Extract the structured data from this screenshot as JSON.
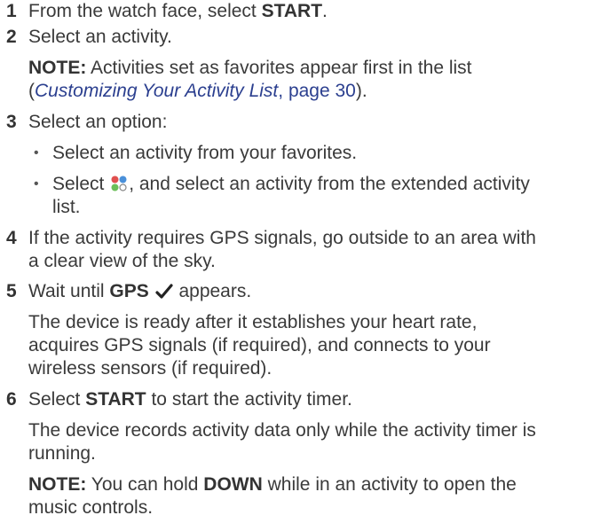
{
  "steps": [
    {
      "number": "1",
      "pre": "From the watch face, select ",
      "bold": "START",
      "post": "."
    },
    {
      "number": "2",
      "text": "Select an activity.",
      "note_label": "NOTE:",
      "note_text": " Activities set as favorites appear first in the list",
      "note_paren_open": "(",
      "note_link": "Customizing Your Activity List",
      "note_link_page": ", page 30",
      "note_paren_close": ")."
    },
    {
      "number": "3",
      "text": "Select an option:",
      "bullets": [
        {
          "text": "Select an activity from your favorites."
        },
        {
          "pre": "Select ",
          "icon": "four-dots-icon",
          "post": ", and select an activity from the extended activity",
          "post2": "list."
        }
      ]
    },
    {
      "number": "4",
      "line1": "If the activity requires GPS signals, go outside to an area with",
      "line2": "a clear view of the sky."
    },
    {
      "number": "5",
      "pre": "Wait until ",
      "bold": "GPS",
      "icon": "checkmark-icon",
      "post": " appears.",
      "para_line1": "The device is ready after it establishes your heart rate,",
      "para_line2": "acquires GPS signals (if required), and connects to your",
      "para_line3": "wireless sensors (if required)."
    },
    {
      "number": "6",
      "pre": "Select ",
      "bold": "START",
      "post": " to start the activity timer.",
      "para_line1": "The device records activity data only while the activity timer is",
      "para_line2": "running.",
      "note_label": "NOTE:",
      "note_pre": " You can hold ",
      "note_bold": "DOWN",
      "note_post": " while in an activity to open the",
      "note_line2": "music controls."
    }
  ],
  "colors": {
    "text": "#3a3a3a",
    "link": "#2b3f8f",
    "icon_dots": [
      "#e0504f",
      "#4a90d9",
      "#6bbf59",
      "#888888"
    ]
  }
}
